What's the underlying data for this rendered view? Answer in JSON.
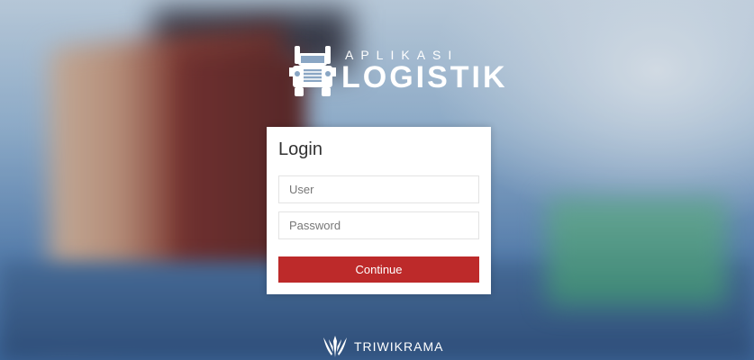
{
  "logo": {
    "top_text": "APLIKASI",
    "main_text": "LOGISTIK",
    "icon": "truck-icon"
  },
  "login": {
    "title": "Login",
    "user_placeholder": "User",
    "user_value": "",
    "password_placeholder": "Password",
    "password_value": "",
    "continue_label": "Continue",
    "button_color": "#bd2a2a"
  },
  "footer": {
    "brand_name": "TRIWIKRAMA",
    "icon": "triwikrama-logo-icon"
  }
}
